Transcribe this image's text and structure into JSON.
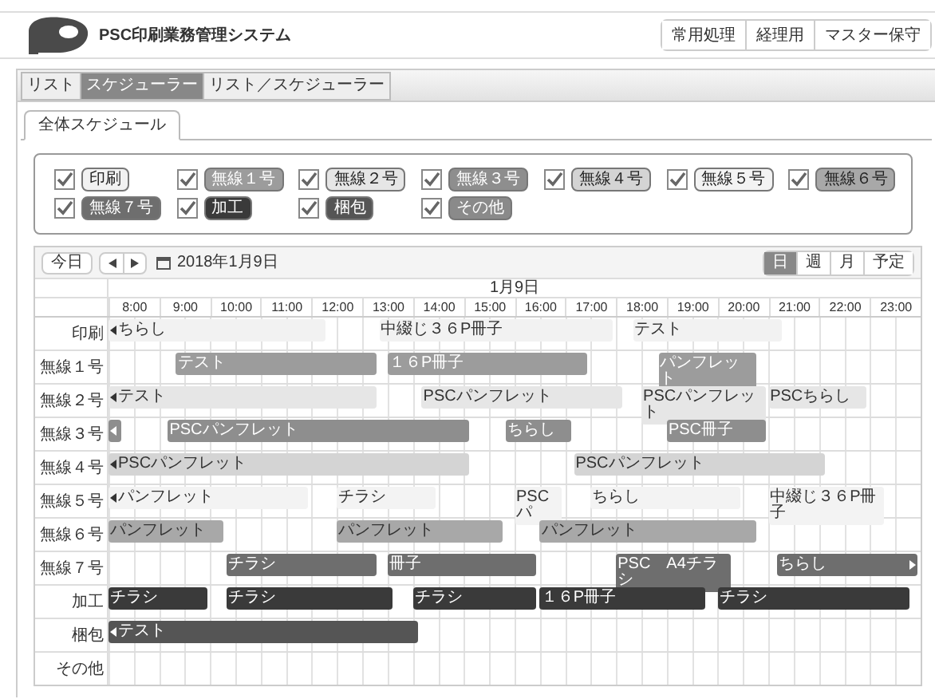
{
  "header": {
    "title": "PSC印刷業務管理システム",
    "nav": [
      {
        "label": "常用処理"
      },
      {
        "label": "経理用"
      },
      {
        "label": "マスター保守"
      }
    ]
  },
  "tabs": [
    {
      "label": "リスト",
      "selected": false
    },
    {
      "label": "スケジューラー",
      "selected": true
    },
    {
      "label": "リスト／スケジューラー",
      "selected": false
    }
  ],
  "subtabs": [
    {
      "label": "全体スケジュール",
      "selected": true
    }
  ],
  "filters": [
    {
      "label": "印刷",
      "checked": true,
      "color": "#f2f2f2"
    },
    {
      "label": "無線１号",
      "checked": true,
      "color": "#9c9c9c"
    },
    {
      "label": "無線２号",
      "checked": true,
      "color": "#e6e6e6"
    },
    {
      "label": "無線３号",
      "checked": true,
      "color": "#8e8e8e"
    },
    {
      "label": "無線４号",
      "checked": true,
      "color": "#d4d4d4"
    },
    {
      "label": "無線５号",
      "checked": true,
      "color": "#f3f3f3"
    },
    {
      "label": "無線６号",
      "checked": true,
      "color": "#a8a8a8"
    },
    {
      "label": "無線７号",
      "checked": true,
      "color": "#6e6e6e"
    },
    {
      "label": "加工",
      "checked": true,
      "color": "#3a3a3a"
    },
    {
      "label": "梱包",
      "checked": true,
      "color": "#555555"
    },
    {
      "label": "その他",
      "checked": true,
      "color": "#8a8a8a"
    }
  ],
  "toolbar": {
    "today": "今日",
    "date": "2018年1月9日",
    "views": [
      {
        "label": "日",
        "selected": true
      },
      {
        "label": "週",
        "selected": false
      },
      {
        "label": "月",
        "selected": false
      },
      {
        "label": "予定",
        "selected": false
      }
    ]
  },
  "calendar": {
    "date_header": "1月9日",
    "hours": [
      "8:00",
      "9:00",
      "10:00",
      "11:00",
      "12:00",
      "13:00",
      "14:00",
      "15:00",
      "16:00",
      "17:00",
      "18:00",
      "19:00",
      "20:00",
      "21:00",
      "22:00",
      "23:00"
    ],
    "rows": [
      {
        "label": "印刷",
        "events": [
          {
            "label": "ちらし",
            "continues_before": true,
            "continues_after": false
          },
          {
            "label": "中綴じ３６P冊子",
            "continues_before": false,
            "continues_after": false
          },
          {
            "label": "テスト",
            "continues_before": false,
            "continues_after": false
          }
        ]
      },
      {
        "label": "無線１号",
        "events": [
          {
            "label": "テスト",
            "continues_before": false,
            "continues_after": false
          },
          {
            "label": "１６P冊子",
            "continues_before": false,
            "continues_after": false
          },
          {
            "label": "パンフレット",
            "continues_before": false,
            "continues_after": false
          }
        ]
      },
      {
        "label": "無線２号",
        "events": [
          {
            "label": "テスト",
            "continues_before": true,
            "continues_after": false
          },
          {
            "label": "PSCパンフレット",
            "continues_before": false,
            "continues_after": false
          },
          {
            "label": "PSCパンフレット",
            "continues_before": false,
            "continues_after": false
          },
          {
            "label": "PSCちらし",
            "continues_before": false,
            "continues_after": false
          }
        ]
      },
      {
        "label": "無線３号",
        "events": [
          {
            "continues_before": true,
            "continues_after": false
          },
          {
            "label": "PSCパンフレット",
            "continues_before": false,
            "continues_after": false
          },
          {
            "label": "ちらし",
            "continues_before": false,
            "continues_after": false
          },
          {
            "label": "PSC冊子",
            "continues_before": false,
            "continues_after": false
          }
        ]
      },
      {
        "label": "無線４号",
        "events": [
          {
            "label": "PSCパンフレット",
            "continues_before": true,
            "continues_after": false
          },
          {
            "label": "PSCパンフレット",
            "continues_before": false,
            "continues_after": false
          }
        ]
      },
      {
        "label": "無線５号",
        "events": [
          {
            "label": "パンフレット",
            "continues_before": true,
            "continues_after": false
          },
          {
            "label": "チラシ",
            "continues_before": false,
            "continues_after": false
          },
          {
            "label": "PSCパ",
            "continues_before": false,
            "continues_after": false
          },
          {
            "label": "ちらし",
            "continues_before": false,
            "continues_after": false
          },
          {
            "label": "中綴じ３６P冊子",
            "continues_before": false,
            "continues_after": false
          }
        ]
      },
      {
        "label": "無線６号",
        "events": [
          {
            "label": "パンフレット",
            "continues_before": false,
            "continues_after": false
          },
          {
            "label": "パンフレット",
            "continues_before": false,
            "continues_after": false
          },
          {
            "label": "パンフレット",
            "continues_before": false,
            "continues_after": false
          }
        ]
      },
      {
        "label": "無線７号",
        "events": [
          {
            "label": "チラシ",
            "continues_before": false,
            "continues_after": false
          },
          {
            "label": "冊子",
            "continues_before": false,
            "continues_after": false
          },
          {
            "label": "PSC　A4チラシ",
            "continues_before": false,
            "continues_after": false
          },
          {
            "label": "ちらし",
            "continues_before": false,
            "continues_after": true
          }
        ]
      },
      {
        "label": "加工",
        "events": [
          {
            "label": "チラシ",
            "continues_before": false,
            "continues_after": false
          },
          {
            "label": "チラシ",
            "continues_before": false,
            "continues_after": false
          },
          {
            "label": "チラシ",
            "continues_before": false,
            "continues_after": false
          },
          {
            "label": "１６P冊子",
            "continues_before": false,
            "continues_after": false
          },
          {
            "label": "チラシ",
            "continues_before": false,
            "continues_after": false
          }
        ]
      },
      {
        "label": "梱包",
        "events": [
          {
            "label": "テスト",
            "continues_before": true,
            "continues_after": false
          }
        ]
      },
      {
        "label": "その他",
        "events": []
      }
    ]
  }
}
